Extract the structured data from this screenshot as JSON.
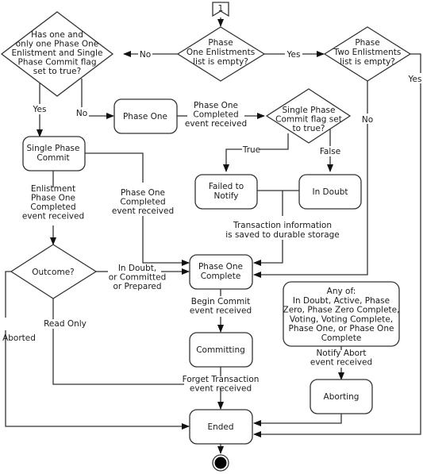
{
  "diagram": {
    "start_marker": {
      "label": "1"
    },
    "decisions": {
      "phase_one_empty": {
        "lines": [
          "Phase",
          "One Enlistments",
          "list is empty?"
        ]
      },
      "phase_two_empty": {
        "lines": [
          "Phase",
          "Two Enlistments",
          "list is empty?"
        ]
      },
      "single_enlistment": {
        "lines": [
          "Has one and",
          "only one Phase One",
          "Enlistment and Single",
          "Phase Commit flag",
          "set to true?"
        ]
      },
      "spc_flag": {
        "lines": [
          "Single Phase",
          "Commit flag set",
          "to true?"
        ]
      },
      "outcome": {
        "lines": [
          "Outcome?"
        ]
      }
    },
    "states": {
      "phase_one": {
        "lines": [
          "Phase One"
        ]
      },
      "single_phase_commit": {
        "lines": [
          "Single Phase",
          "Commit"
        ]
      },
      "failed_to_notify": {
        "lines": [
          "Failed to",
          "Notify"
        ]
      },
      "in_doubt": {
        "lines": [
          "In Doubt"
        ]
      },
      "phase_one_complete": {
        "lines": [
          "Phase One",
          "Complete"
        ]
      },
      "committing": {
        "lines": [
          "Committing"
        ]
      },
      "any_of": {
        "lines": [
          "Any of:",
          "In Doubt, Active, Phase",
          "Zero, Phase Zero Complete,",
          "Voting, Voting Complete,",
          "Phase One, or Phase One",
          "Complete"
        ]
      },
      "aborting": {
        "lines": [
          "Aborting"
        ]
      },
      "ended": {
        "lines": [
          "Ended"
        ]
      }
    },
    "edge_labels": {
      "no_left": "No",
      "yes_right": "Yes",
      "yes_far_right": "Yes",
      "no_down_right": "No",
      "yes_down_left": "Yes",
      "no_to_phase_one": "No",
      "phase_one_completed": [
        "Phase One",
        "Completed",
        "event received"
      ],
      "true_label": "True",
      "false_label": "False",
      "enlistment_completed": [
        "Enlistment",
        "Phase One",
        "Completed",
        "event received"
      ],
      "spc_phase_one_completed": [
        "Phase One",
        "Completed",
        "event received"
      ],
      "durable_storage": [
        "Transaction information",
        "is saved to durable storage"
      ],
      "outcome_to_complete": [
        "In Doubt,",
        "or Committed",
        "or Prepared"
      ],
      "read_only": "Read Only",
      "aborted": "Aborted",
      "begin_commit": [
        "Begin Commit",
        "event received"
      ],
      "forget_transaction": [
        "Forget Transaction",
        "event received"
      ],
      "notify_abort": [
        "Notify Abort",
        "event received"
      ]
    },
    "end_marker": "final-state"
  }
}
